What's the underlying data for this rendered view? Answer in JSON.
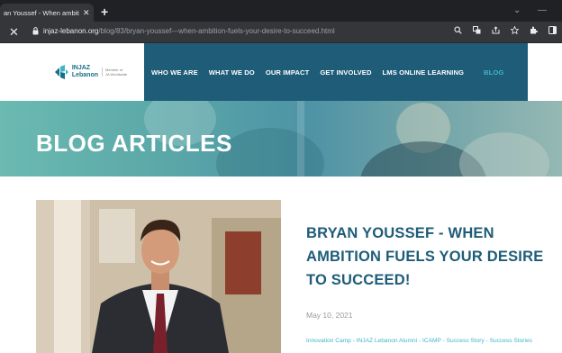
{
  "browser": {
    "tab_title": "an Youssef - When ambition f",
    "tab_close": "✕",
    "new_tab": "+",
    "minimize": "—",
    "collapse": "⌄",
    "close_window": "✕",
    "url_host": "injaz-lebanon.org",
    "url_path": "/blog/83/bryan-youssef---when-ambition-fuels-your-desire-to-succeed.html",
    "stop": "✕"
  },
  "site": {
    "logo_name_line1": "INJAZ",
    "logo_name_line2": "Lebanon",
    "logo_tagline_line1": "Member of",
    "logo_tagline_line2": "JA Worldwide",
    "brand_color": "#1e5c78",
    "accent_color": "#3fb5c9",
    "nav": [
      {
        "label": "WHO WE ARE"
      },
      {
        "label": "WHAT WE DO"
      },
      {
        "label": "OUR IMPACT"
      },
      {
        "label": "GET INVOLVED"
      },
      {
        "label": "LMS ONLINE LEARNING"
      },
      {
        "label": "BLOG"
      }
    ]
  },
  "hero": {
    "title": "BLOG ARTICLES"
  },
  "post": {
    "title": "BRYAN YOUSSEF - WHEN AMBITION FUELS YOUR DESIRE TO SUCCEED!",
    "date": "May 10, 2021",
    "tags": "Innovation Camp - INJAZ Lebanon Alumni - ICAMP - Success Story - Success Stories"
  }
}
